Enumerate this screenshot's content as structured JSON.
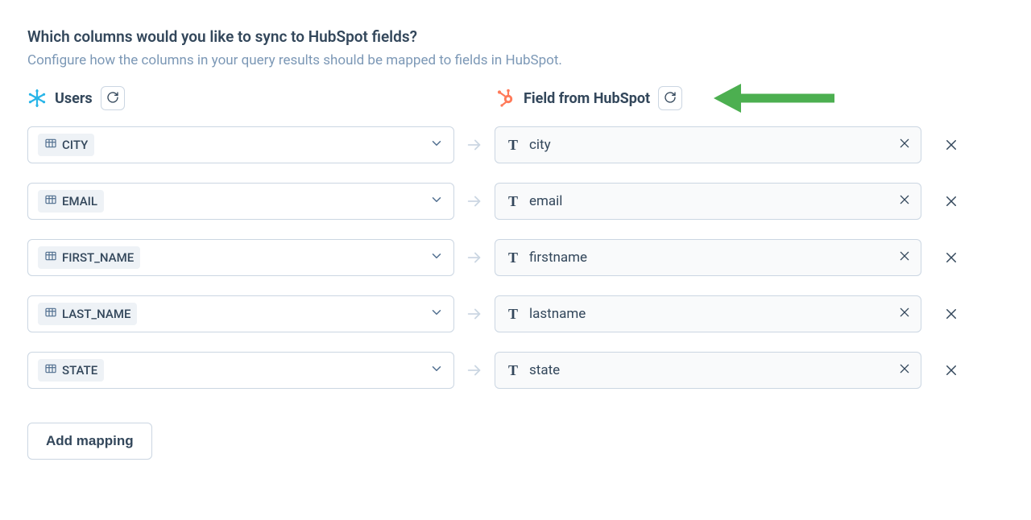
{
  "heading": "Which columns would you like to sync to HubSpot fields?",
  "subheading": "Configure how the columns in your query results should be mapped to fields in HubSpot.",
  "source_header": "Users",
  "dest_header": "Field from HubSpot",
  "type_glyph": "T",
  "mappings": [
    {
      "source": "CITY",
      "dest": "city"
    },
    {
      "source": "EMAIL",
      "dest": "email"
    },
    {
      "source": "FIRST_NAME",
      "dest": "firstname"
    },
    {
      "source": "LAST_NAME",
      "dest": "lastname"
    },
    {
      "source": "STATE",
      "dest": "state"
    }
  ],
  "add_mapping_label": "Add mapping"
}
